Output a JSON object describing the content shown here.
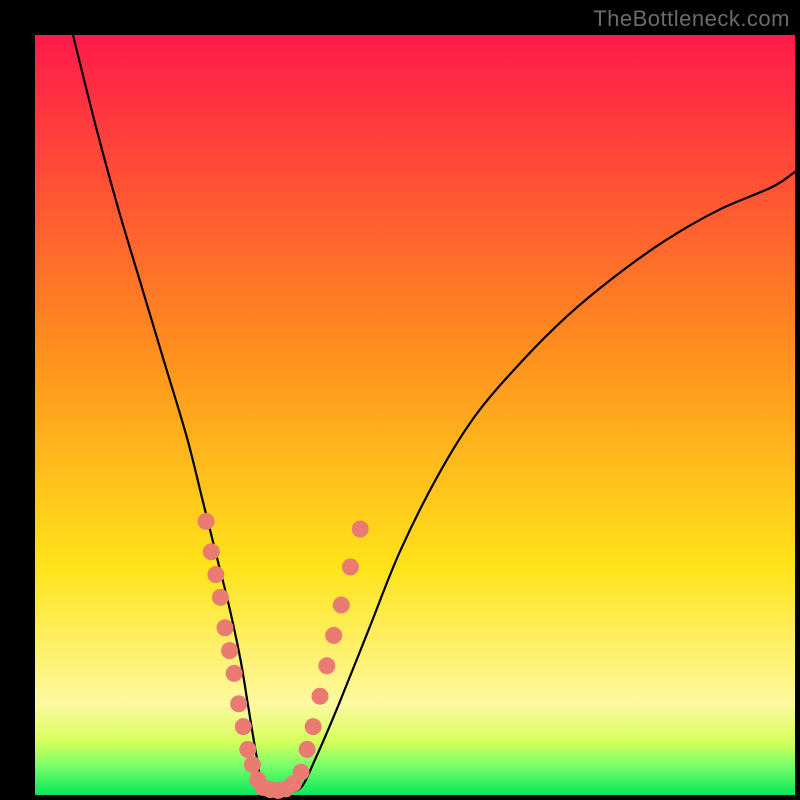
{
  "watermark": "TheBottleneck.com",
  "colors": {
    "top": "#ff1a4b",
    "orange": "#ff8a1f",
    "yellow": "#ffe31a",
    "paleyellow": "#fdf9a0",
    "limeyellow": "#d6ff5c",
    "palegreen": "#7dff6a",
    "green": "#08e85a",
    "bead": "#e97b72"
  },
  "chart_data": {
    "type": "line",
    "title": "",
    "xlabel": "",
    "ylabel": "",
    "xlim": [
      0,
      100
    ],
    "ylim": [
      0,
      100
    ],
    "series": [
      {
        "name": "bottleneck-curve",
        "x": [
          5,
          8,
          11,
          14,
          17,
          20,
          22,
          24,
          25.5,
          27,
          28,
          29,
          30,
          31.5,
          33,
          35,
          37,
          40,
          44,
          48,
          53,
          58,
          64,
          70,
          76,
          83,
          90,
          97,
          100
        ],
        "y": [
          100,
          88,
          77,
          67,
          57,
          47,
          39,
          31,
          25,
          18,
          12,
          6,
          1,
          0.5,
          0.5,
          1,
          5,
          12,
          22,
          32,
          42,
          50,
          57,
          63,
          68,
          73,
          77,
          80,
          82
        ]
      }
    ],
    "beads": {
      "name": "marker-cluster",
      "comment": "salmon circular markers near the curve minimum",
      "points": [
        {
          "x": 22.5,
          "y": 36
        },
        {
          "x": 23.2,
          "y": 32
        },
        {
          "x": 23.8,
          "y": 29
        },
        {
          "x": 24.4,
          "y": 26
        },
        {
          "x": 25.0,
          "y": 22
        },
        {
          "x": 25.6,
          "y": 19
        },
        {
          "x": 26.2,
          "y": 16
        },
        {
          "x": 26.8,
          "y": 12
        },
        {
          "x": 27.4,
          "y": 9
        },
        {
          "x": 28.0,
          "y": 6
        },
        {
          "x": 28.6,
          "y": 4
        },
        {
          "x": 29.3,
          "y": 2
        },
        {
          "x": 30.0,
          "y": 1
        },
        {
          "x": 31.0,
          "y": 0.7
        },
        {
          "x": 32.0,
          "y": 0.6
        },
        {
          "x": 33.0,
          "y": 0.8
        },
        {
          "x": 34.0,
          "y": 1.5
        },
        {
          "x": 35.0,
          "y": 3
        },
        {
          "x": 35.8,
          "y": 6
        },
        {
          "x": 36.6,
          "y": 9
        },
        {
          "x": 37.5,
          "y": 13
        },
        {
          "x": 38.4,
          "y": 17
        },
        {
          "x": 39.3,
          "y": 21
        },
        {
          "x": 40.3,
          "y": 25
        },
        {
          "x": 41.5,
          "y": 30
        },
        {
          "x": 42.8,
          "y": 35
        }
      ]
    }
  }
}
